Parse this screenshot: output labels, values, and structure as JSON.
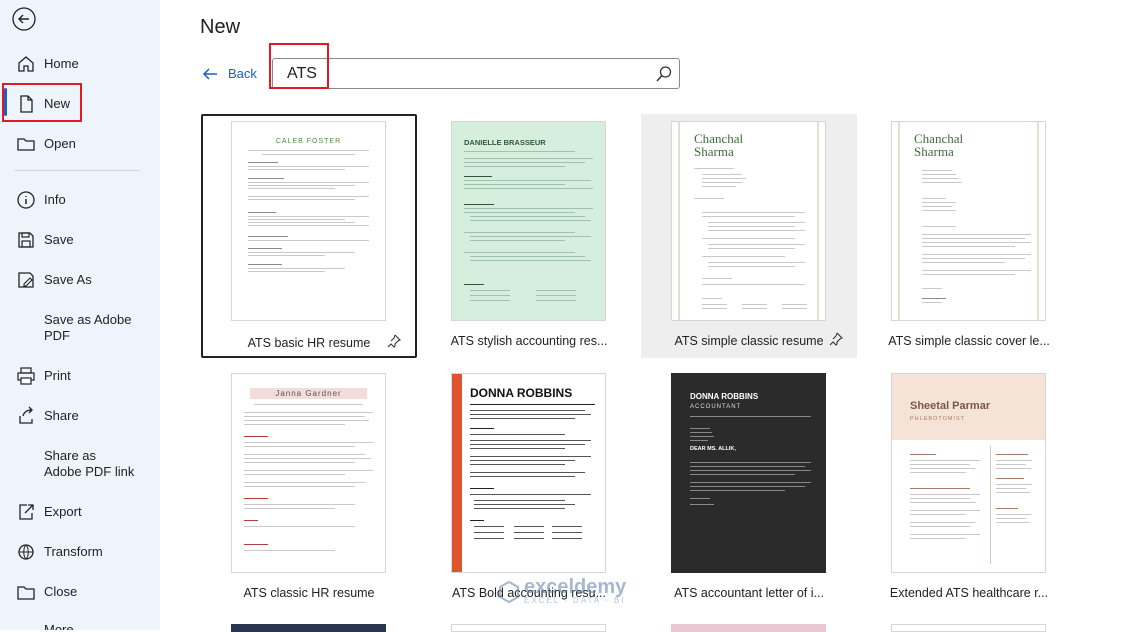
{
  "sidebar": {
    "items": [
      {
        "label": "Home",
        "icon": "home-icon"
      },
      {
        "label": "New",
        "icon": "new-document-icon"
      },
      {
        "label": "Open",
        "icon": "folder-icon"
      },
      {
        "label": "Info",
        "icon": "info-icon"
      },
      {
        "label": "Save",
        "icon": "save-icon"
      },
      {
        "label": "Save As",
        "icon": "save-as-icon"
      },
      {
        "label": "Save as Adobe PDF",
        "icon": ""
      },
      {
        "label": "Print",
        "icon": "print-icon"
      },
      {
        "label": "Share",
        "icon": "share-icon"
      },
      {
        "label": "Share as Adobe PDF link",
        "icon": ""
      },
      {
        "label": "Export",
        "icon": "export-icon"
      },
      {
        "label": "Transform",
        "icon": "transform-icon"
      },
      {
        "label": "Close",
        "icon": "close-folder-icon"
      },
      {
        "label": "More...",
        "icon": ""
      }
    ]
  },
  "main": {
    "title": "New",
    "back_label": "Back",
    "search": {
      "value": "ATS",
      "placeholder": ""
    }
  },
  "templates": [
    {
      "label": "ATS basic HR resume",
      "name": "CALEB FOSTER",
      "accent": "#4f8a3c"
    },
    {
      "label": "ATS stylish accounting res...",
      "name": "DANIELLE BRASSEUR",
      "accent": "#d6eedd"
    },
    {
      "label": "ATS simple classic resume",
      "name": "Chanchal Sharma",
      "accent": "#3f6b3a"
    },
    {
      "label": "ATS simple classic cover le...",
      "name": "Chanchal Sharma",
      "accent": "#3f6b3a"
    },
    {
      "label": "ATS classic HR resume",
      "name": "Janna Gardner",
      "accent": "#b23a3a"
    },
    {
      "label": "ATS Bold accounting resu...",
      "name": "DONNA ROBBINS",
      "accent": "#e0532f"
    },
    {
      "label": "ATS accountant letter of i...",
      "name": "DONNA ROBBINS",
      "subtitle": "ACCOUNTANT",
      "greeting": "DEAR MS. ALLIK,",
      "accent": "#2b2b2b"
    },
    {
      "label": "Extended ATS healthcare r...",
      "name": "Sheetal Parmar",
      "subtitle": "PHLEBOTOMIST",
      "accent": "#f6e3d8"
    }
  ],
  "watermark": {
    "name": "exceldemy",
    "sub": "EXCEL · DATA · BI"
  },
  "colors": {
    "accent": "#1e5fbf",
    "highlight": "#e01b24",
    "sidebar_bg": "#eef4fb"
  }
}
